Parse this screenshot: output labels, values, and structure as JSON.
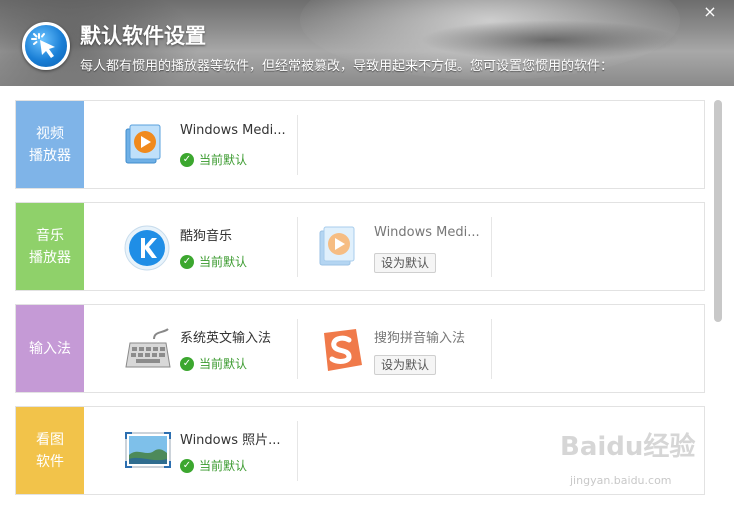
{
  "header": {
    "title": "默认软件设置",
    "subtitle": "每人都有惯用的播放器等软件，但经常被篡改，导致用起来不方便。您可设置您惯用的软件：",
    "close_label": "×"
  },
  "categories": [
    {
      "line1": "视频",
      "line2": "播放器",
      "color": "#7fb4e8",
      "apps": [
        {
          "name": "Windows Medi...",
          "status": "当前默认",
          "icon": "windows-media-player-icon"
        }
      ]
    },
    {
      "line1": "音乐",
      "line2": "播放器",
      "color": "#8fd16a",
      "apps": [
        {
          "name": "酷狗音乐",
          "status": "当前默认",
          "icon": "kugou-music-icon"
        },
        {
          "name": "Windows Medi...",
          "button": "设为默认",
          "icon": "windows-media-player-icon"
        }
      ]
    },
    {
      "line1": "输入法",
      "line2": "",
      "color": "#c59ad6",
      "apps": [
        {
          "name": "系统英文输入法",
          "status": "当前默认",
          "icon": "keyboard-icon"
        },
        {
          "name": "搜狗拼音输入法",
          "button": "设为默认",
          "icon": "sogou-input-icon"
        }
      ]
    },
    {
      "line1": "看图",
      "line2": "软件",
      "color": "#f2c34a",
      "apps": [
        {
          "name": "Windows 照片...",
          "status": "当前默认",
          "icon": "windows-photo-viewer-icon"
        }
      ]
    }
  ],
  "watermark": {
    "text": "Baidu经验",
    "sub": "jingyan.baidu.com"
  },
  "colors": {
    "status_green": "#3a9a2e"
  }
}
